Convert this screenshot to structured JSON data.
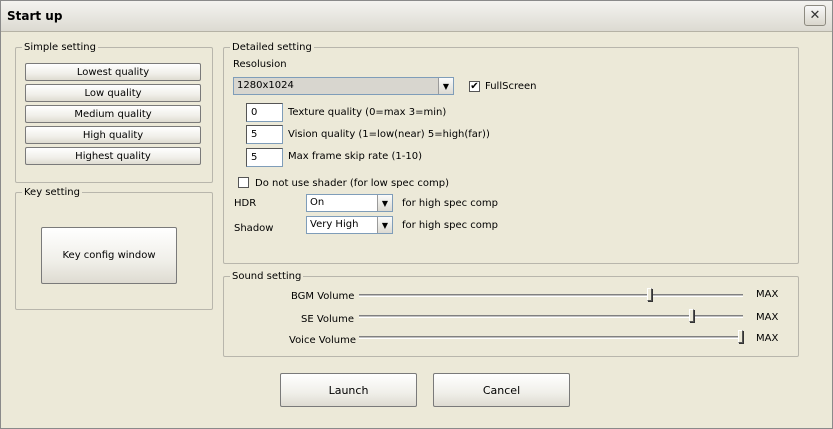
{
  "window": {
    "title": "Start up"
  },
  "simple": {
    "legend": "Simple setting",
    "buttons": [
      "Lowest quality",
      "Low quality",
      "Medium quality",
      "High quality",
      "Highest quality"
    ]
  },
  "key": {
    "legend": "Key setting",
    "button": "Key config window"
  },
  "detailed": {
    "legend": "Detailed setting",
    "resolution_label": "Resolusion",
    "resolution_value": "1280x1024",
    "fullscreen_label": "FullScreen",
    "fullscreen_checked": true,
    "texture_value": "0",
    "texture_label": "Texture quality (0=max 3=min)",
    "vision_value": "5",
    "vision_label": "Vision quality (1=low(near) 5=high(far))",
    "frameskip_value": "5",
    "frameskip_label": "Max frame skip rate (1-10)",
    "noshader_label": "Do not use shader (for low spec comp)",
    "noshader_checked": false,
    "hdr_label": "HDR",
    "hdr_value": "On",
    "hdr_note": "for high spec comp",
    "shadow_label": "Shadow",
    "shadow_value": "Very High",
    "shadow_note": "for high spec comp"
  },
  "sound": {
    "legend": "Sound setting",
    "bgm_label": "BGM Volume",
    "se_label": "SE Volume",
    "voice_label": "Voice Volume",
    "max_label": "MAX",
    "bgm_level": 0.76,
    "se_level": 0.87,
    "voice_level": 1.0
  },
  "actions": {
    "launch": "Launch",
    "cancel": "Cancel"
  },
  "icons": {
    "checkmark": "✔",
    "dropdown": "▼",
    "close": "✕"
  }
}
